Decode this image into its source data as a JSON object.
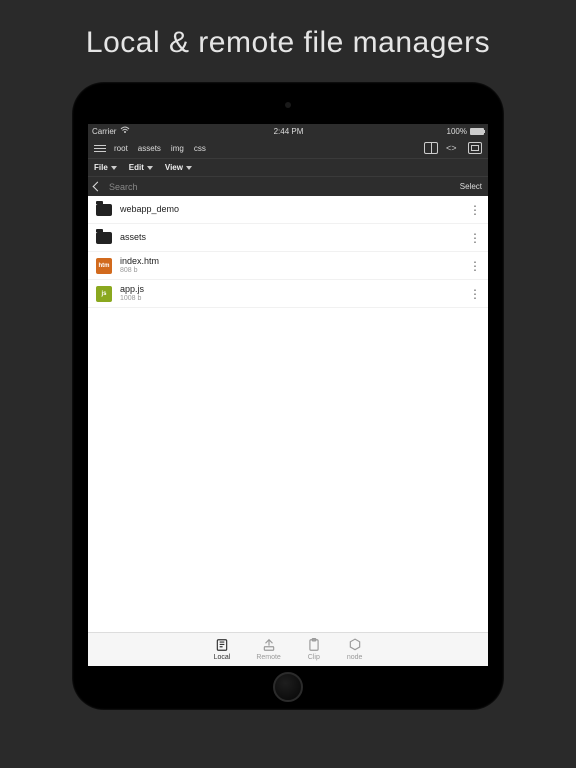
{
  "headline": "Local & remote file managers",
  "status": {
    "carrier": "Carrier",
    "time": "2:44 PM",
    "battery": "100%"
  },
  "breadcrumbs": [
    "root",
    "assets",
    "img",
    "css"
  ],
  "menus": {
    "file": "File",
    "edit": "Edit",
    "view": "View"
  },
  "search": {
    "placeholder": "Search",
    "select": "Select"
  },
  "files": [
    {
      "kind": "folder",
      "name": "webapp_demo",
      "meta": ""
    },
    {
      "kind": "folder",
      "name": "assets",
      "meta": ""
    },
    {
      "kind": "htm",
      "name": "index.htm",
      "meta": "808 b"
    },
    {
      "kind": "js",
      "name": "app.js",
      "meta": "1008 b"
    }
  ],
  "tabs": {
    "local": "Local",
    "remote": "Remote",
    "clip": "Clip",
    "node": "node"
  },
  "icons": {
    "htm_badge": "htm",
    "js_badge": "js"
  }
}
